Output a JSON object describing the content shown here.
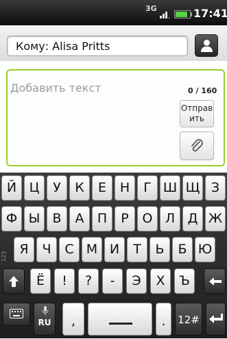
{
  "status_bar": {
    "network": "3G",
    "time": "17:41",
    "battery_level": 0.85
  },
  "recipient": {
    "text": "Кому: Alisa Pritts"
  },
  "compose": {
    "placeholder": "Добавить текст",
    "counter": "0 / 160",
    "send_line1": "Отправ",
    "send_line2": "ить"
  },
  "keyboard": {
    "row1": [
      "Й",
      "Ц",
      "У",
      "К",
      "Е",
      "Н",
      "Г",
      "Ш",
      "Щ",
      "З"
    ],
    "row2": [
      "Ф",
      "Ы",
      "В",
      "А",
      "П",
      "Р",
      "О",
      "Л",
      "Д",
      "Ж"
    ],
    "row3": [
      "Я",
      "Ч",
      "С",
      "М",
      "И",
      "Т",
      "Ь",
      "Б",
      "Ю"
    ],
    "row4": [
      "Ё",
      "!",
      "?",
      "-",
      "Э",
      "Х",
      "Ъ"
    ],
    "side_label": "123",
    "lang_label": "RU",
    "comma": ",",
    "period": ".",
    "num_label": "12#",
    "shift_icon": "shift-arrow-icon",
    "backspace_icon": "backspace-icon",
    "enter_icon": "enter-icon"
  }
}
